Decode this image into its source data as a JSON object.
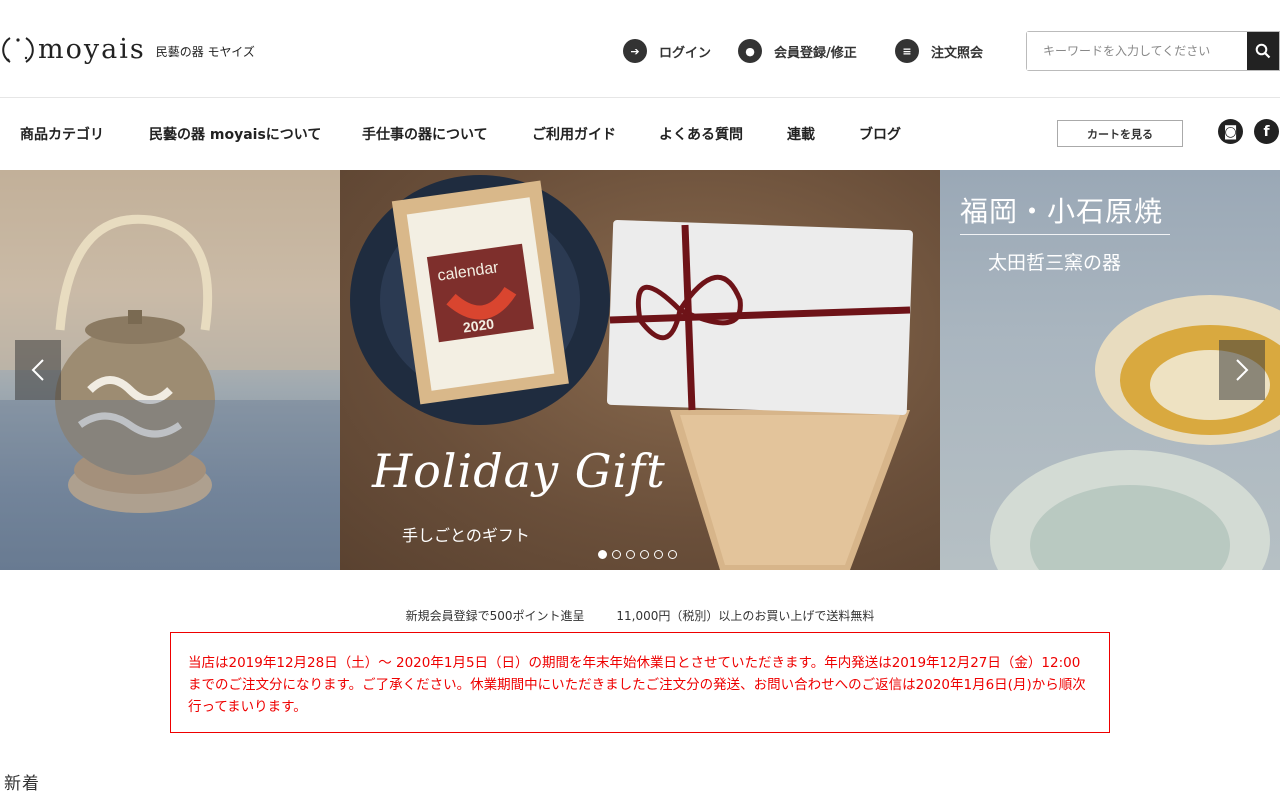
{
  "header": {
    "logo_text": "moyais",
    "logo_sub": "民藝の器 モヤイズ",
    "links": [
      {
        "label": "ログイン",
        "icon": "login-icon"
      },
      {
        "label": "会員登録/修正",
        "icon": "user-icon"
      },
      {
        "label": "注文照会",
        "icon": "list-icon"
      }
    ],
    "search": {
      "placeholder": "キーワードを入力してください",
      "value": ""
    }
  },
  "nav": {
    "items": [
      "商品カテゴリ",
      "民藝の器 moyaisについて",
      "手仕事の器について",
      "ご利用ガイド",
      "よくある質問",
      "連載",
      "ブログ"
    ],
    "cart_label": "カートを見る",
    "social": [
      {
        "name": "instagram-icon",
        "glyph": "◙"
      },
      {
        "name": "facebook-icon",
        "glyph": "f"
      }
    ]
  },
  "slider": {
    "center_script": "Holiday Gift",
    "center_sub": "手しごとのギフト",
    "calendar_word": "calendar",
    "calendar_year": "2020",
    "right_title": "福岡・小石原焼",
    "right_sub": "太田哲三窯の器",
    "dot_count": 6,
    "active_dot": 0
  },
  "info": {
    "points": "新規会員登録で500ポイント進呈",
    "shipping": "11,000円（税別）以上のお買い上げで送料無料"
  },
  "notice": "当店は2019年12月28日（土）～ 2020年1月5日（日）の期間を年末年始休業日とさせていただきます。年内発送は2019年12月27日（金）12:00までのご注文分になります。ご了承ください。休業期間中にいただきましたご注文分の発送、お問い合わせへのご返信は2020年1月6日(月)から順次行ってまいります。",
  "section_new": "新着",
  "colors": {
    "notice": "#e00000",
    "dark": "#222222"
  }
}
